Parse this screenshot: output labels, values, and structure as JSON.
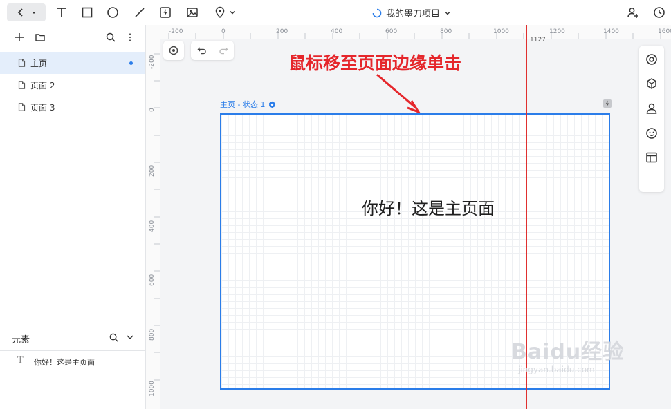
{
  "toolbar": {
    "project_name": "我的墨刀项目"
  },
  "pages": {
    "items": [
      {
        "label": "主页",
        "active": true
      },
      {
        "label": "页面 2",
        "active": false
      },
      {
        "label": "页面 3",
        "active": false
      }
    ]
  },
  "elements": {
    "title": "元素",
    "items": [
      {
        "label": "你好！这是主页面"
      }
    ]
  },
  "canvas": {
    "ruler_x": [
      "-200",
      "0",
      "200",
      "400",
      "600",
      "800",
      "1000",
      "1127",
      "1200",
      "1400",
      "1600"
    ],
    "ruler_y": [
      "-200",
      "0",
      "200",
      "400",
      "600",
      "800",
      "1000"
    ],
    "frame_label": "主页 - 状态 1",
    "frame_text": "你好！这是主页面",
    "annotation": "鼠标移至页面边缘单击",
    "watermark": "Baidu经验",
    "watermark_url": "jingyan.baidu.com"
  },
  "colors": {
    "accent": "#2b7de9",
    "annotation": "#e5262b",
    "guide_line": "#e0302f"
  },
  "icons": [
    "back-icon",
    "dropdown-icon",
    "text-tool-icon",
    "rectangle-tool-icon",
    "ellipse-tool-icon",
    "line-tool-icon",
    "component-tool-icon",
    "image-tool-icon",
    "location-tool-icon",
    "add-page-icon",
    "folder-icon",
    "search-icon",
    "more-icon",
    "page-icon",
    "loading-icon",
    "add-user-icon",
    "history-icon",
    "target-icon",
    "undo-icon",
    "redo-icon",
    "interaction-icon",
    "cube-icon",
    "person-icon",
    "smile-icon",
    "layout-icon"
  ]
}
